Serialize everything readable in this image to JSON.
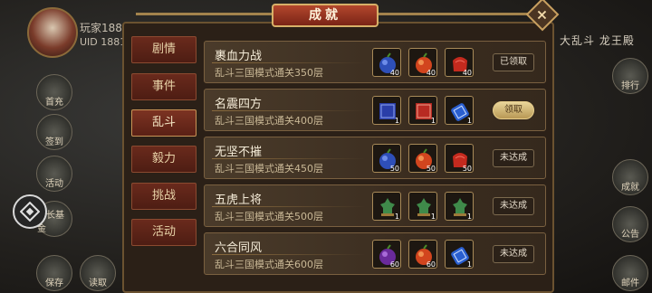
{
  "player": {
    "name": "玩家188",
    "uid": "UID 1881"
  },
  "top_right_text": "大乱斗 龙王殿",
  "left_buttons": [
    {
      "label": "首充",
      "icon": "gift-icon"
    },
    {
      "label": "签到",
      "icon": "calendar-icon"
    },
    {
      "label": "活动",
      "icon": "flag-icon"
    },
    {
      "label": "成长基金",
      "icon": "chest-icon"
    },
    {
      "label": "保存",
      "icon": "save-icon"
    },
    {
      "label": "读取",
      "icon": "load-icon"
    }
  ],
  "right_buttons": [
    {
      "label": "排行",
      "icon": "rank-icon"
    },
    {
      "label": "成就",
      "icon": "trophy-icon"
    },
    {
      "label": "公告",
      "icon": "scroll-icon"
    },
    {
      "label": "邮件",
      "icon": "mail-icon"
    }
  ],
  "dialog": {
    "title": "成就",
    "close_icon": "close-icon"
  },
  "tabs": [
    {
      "label": "剧情",
      "active": false
    },
    {
      "label": "事件",
      "active": false
    },
    {
      "label": "乱斗",
      "active": true
    },
    {
      "label": "毅力",
      "active": false
    },
    {
      "label": "挑战",
      "active": false
    },
    {
      "label": "活动",
      "active": false
    }
  ],
  "achievements": [
    {
      "name": "裹血力战",
      "desc": "乱斗三国模式通关350层",
      "rewards": [
        {
          "icon": "blue-fruit-icon",
          "count": "40"
        },
        {
          "icon": "red-fruit-icon",
          "count": "40"
        },
        {
          "icon": "red-bag-icon",
          "count": "40"
        }
      ],
      "status": "已领取",
      "status_type": "done"
    },
    {
      "name": "名震四方",
      "desc": "乱斗三国模式通关400层",
      "rewards": [
        {
          "icon": "blue-book-icon",
          "count": "1"
        },
        {
          "icon": "red-book-icon",
          "count": "1"
        },
        {
          "icon": "blue-scroll-icon",
          "count": "1"
        }
      ],
      "status": "领取",
      "status_type": "claim"
    },
    {
      "name": "无坚不摧",
      "desc": "乱斗三国模式通关450层",
      "rewards": [
        {
          "icon": "blue-fruit-icon",
          "count": "50"
        },
        {
          "icon": "red-fruit-icon",
          "count": "50"
        },
        {
          "icon": "red-bag-icon",
          "count": "50"
        }
      ],
      "status": "未达成",
      "status_type": "pending"
    },
    {
      "name": "五虎上将",
      "desc": "乱斗三国模式通关500层",
      "rewards": [
        {
          "icon": "green-statue-icon",
          "count": "1"
        },
        {
          "icon": "green-statue-icon",
          "count": "1"
        },
        {
          "icon": "green-statue-icon",
          "count": "1"
        }
      ],
      "status": "未达成",
      "status_type": "pending"
    },
    {
      "name": "六合同风",
      "desc": "乱斗三国模式通关600层",
      "rewards": [
        {
          "icon": "purple-fruit-icon",
          "count": "60"
        },
        {
          "icon": "red-fruit-icon",
          "count": "60"
        },
        {
          "icon": "blue-scroll-icon",
          "count": "1"
        }
      ],
      "status": "未达成",
      "status_type": "pending"
    }
  ]
}
